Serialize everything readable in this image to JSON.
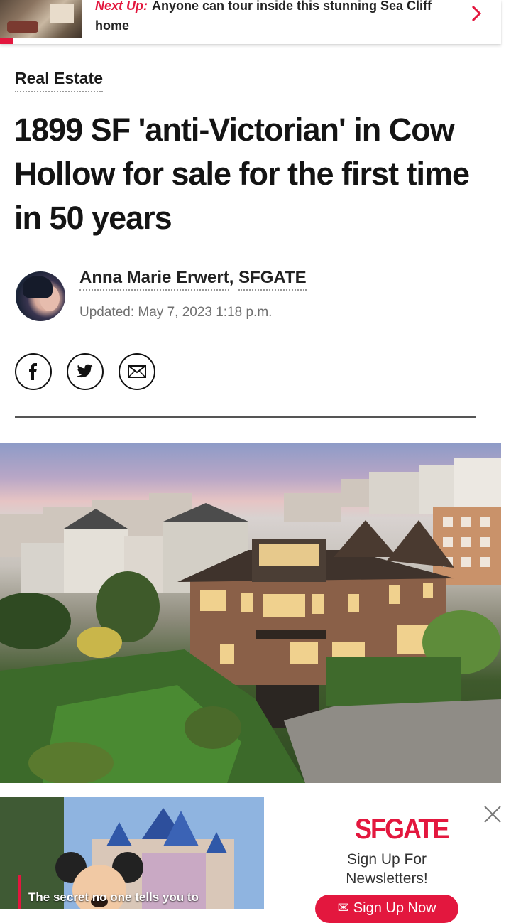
{
  "next_up": {
    "label": "Next Up:",
    "title": "Anyone can tour inside this stunning Sea Cliff home"
  },
  "article": {
    "category": "Real Estate",
    "headline": "1899 SF 'anti-Victorian' in Cow Hollow for sale for the first time in 50 years",
    "author": "Anna Marie Erwert",
    "separator": ",",
    "outlet": "SFGATE",
    "updated": "Updated: May 7, 2023 1:18 p.m."
  },
  "share": {
    "icons": [
      "facebook-icon",
      "twitter-icon",
      "email-icon"
    ]
  },
  "ad": {
    "video_caption": "The secret no one tells you to",
    "brand": "SFGATE",
    "tagline": "Sign Up For Newsletters!",
    "button": "Sign Up Now"
  },
  "colors": {
    "accent": "#e3173e",
    "text": "#141414",
    "muted": "#707070"
  }
}
